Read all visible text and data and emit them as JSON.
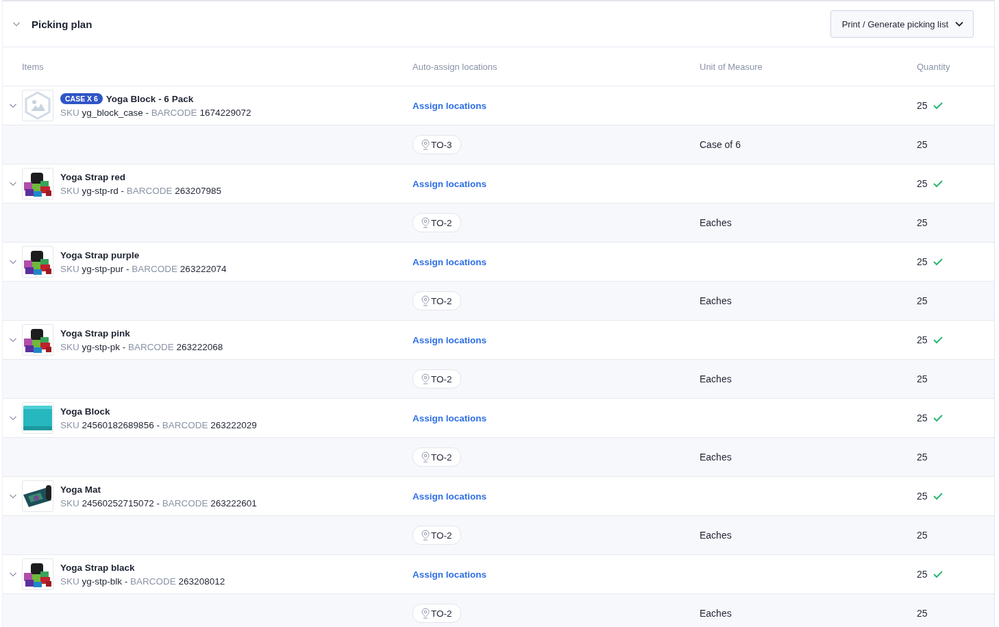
{
  "section": {
    "title": "Picking plan",
    "expanded": true,
    "action_button": "Print / Generate picking list"
  },
  "table": {
    "columns": [
      "Items",
      "Auto-assign locations",
      "Unit of Measure",
      "Quantity"
    ],
    "rows": [
      {
        "image": {
          "kind": "placeholder"
        },
        "badge": "CASE X 6",
        "name": "Yoga Block - 6 Pack",
        "sku_label": "SKU",
        "sku": "yg_block_case -",
        "barcode_label": "BARCODE",
        "barcode": "1674229072",
        "action": "Assign locations",
        "quantity": "25",
        "confirmed": true,
        "expanded": true,
        "location": "TO-3",
        "unit": "Case of 6",
        "location_quantity": "25"
      },
      {
        "image": {
          "kind": "straps"
        },
        "name": "Yoga Strap red",
        "sku_label": "SKU",
        "sku": "yg-stp-rd -",
        "barcode_label": "BARCODE",
        "barcode": "263207985",
        "action": "Assign locations",
        "quantity": "25",
        "confirmed": true,
        "expanded": true,
        "location": "TO-2",
        "unit": "Eaches",
        "location_quantity": "25"
      },
      {
        "image": {
          "kind": "straps"
        },
        "name": "Yoga Strap purple",
        "sku_label": "SKU",
        "sku": "yg-stp-pur -",
        "barcode_label": "BARCODE",
        "barcode": "263222074",
        "action": "Assign locations",
        "quantity": "25",
        "confirmed": true,
        "expanded": true,
        "location": "TO-2",
        "unit": "Eaches",
        "location_quantity": "25"
      },
      {
        "image": {
          "kind": "straps"
        },
        "name": "Yoga Strap pink",
        "sku_label": "SKU",
        "sku": "yg-stp-pk -",
        "barcode_label": "BARCODE",
        "barcode": "263222068",
        "action": "Assign locations",
        "quantity": "25",
        "confirmed": true,
        "expanded": true,
        "location": "TO-2",
        "unit": "Eaches",
        "location_quantity": "25"
      },
      {
        "image": {
          "kind": "block"
        },
        "name": "Yoga Block",
        "sku_label": "SKU",
        "sku": "24560182689856 -",
        "barcode_label": "BARCODE",
        "barcode": "263222029",
        "action": "Assign locations",
        "quantity": "25",
        "confirmed": true,
        "expanded": true,
        "location": "TO-2",
        "unit": "Eaches",
        "location_quantity": "25"
      },
      {
        "image": {
          "kind": "mat"
        },
        "name": "Yoga Mat",
        "sku_label": "SKU",
        "sku": "24560252715072 -",
        "barcode_label": "BARCODE",
        "barcode": "263222601",
        "action": "Assign locations",
        "quantity": "25",
        "confirmed": true,
        "expanded": true,
        "location": "TO-2",
        "unit": "Eaches",
        "location_quantity": "25"
      },
      {
        "image": {
          "kind": "straps"
        },
        "name": "Yoga Strap black",
        "sku_label": "SKU",
        "sku": "yg-stp-blk -",
        "barcode_label": "BARCODE",
        "barcode": "263208012",
        "action": "Assign locations",
        "quantity": "25",
        "confirmed": true,
        "expanded": true,
        "location": "TO-2",
        "unit": "Eaches",
        "location_quantity": "25"
      }
    ]
  }
}
